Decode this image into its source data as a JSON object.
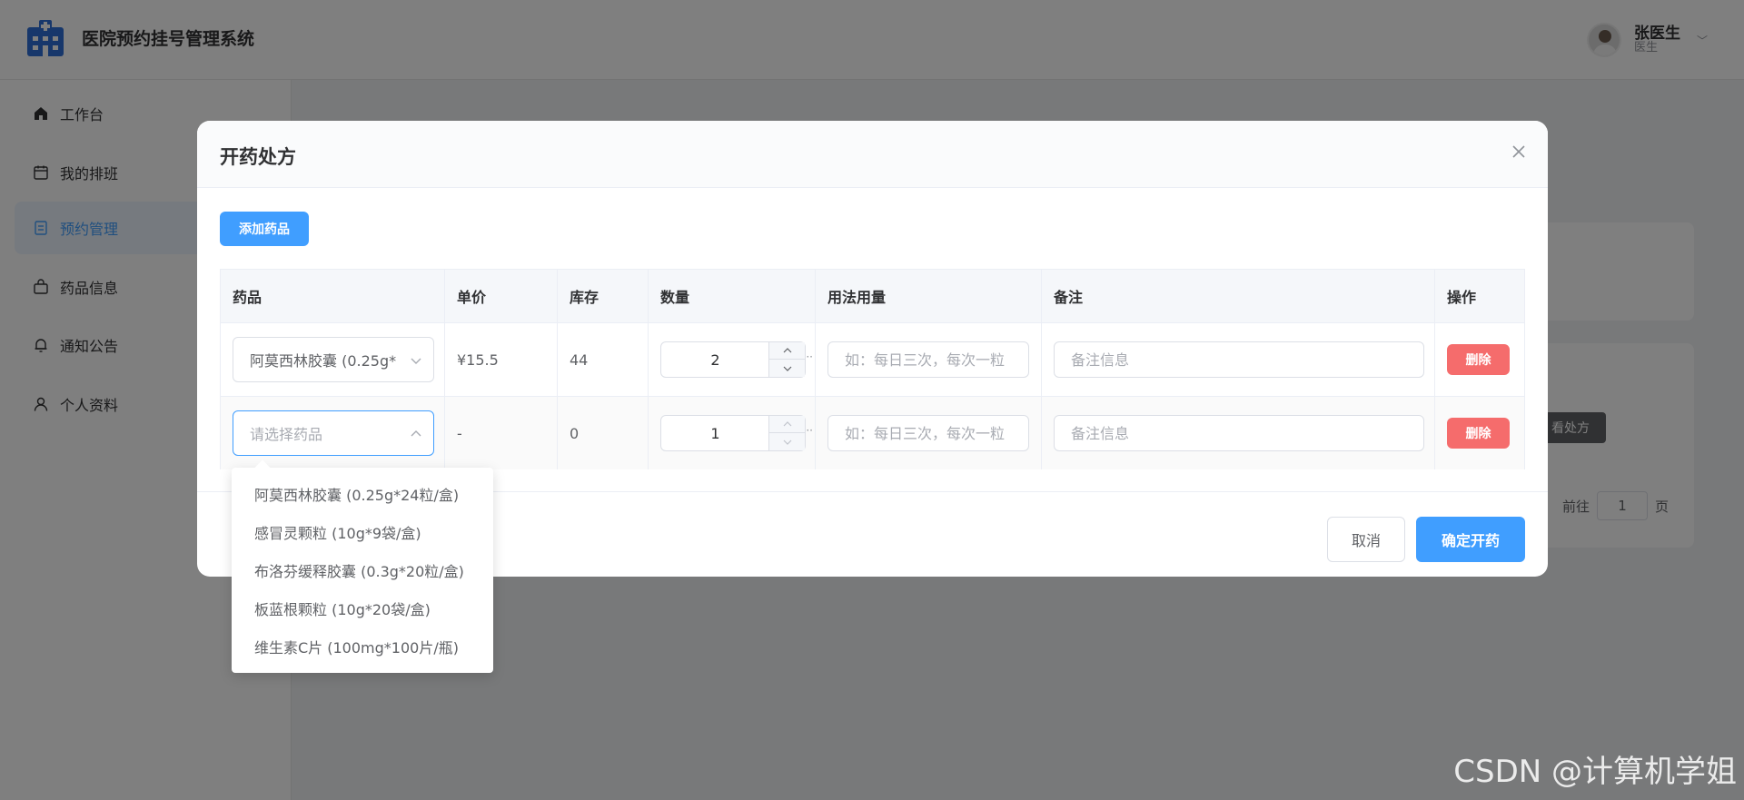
{
  "app": {
    "title": "医院预约挂号管理系统",
    "user_name": "张医生",
    "user_role": "医生"
  },
  "sidebar": {
    "items": [
      {
        "label": "工作台",
        "icon": "home-icon"
      },
      {
        "label": "我的排班",
        "icon": "calendar-icon"
      },
      {
        "label": "预约管理",
        "icon": "document-icon",
        "active": true
      },
      {
        "label": "药品信息",
        "icon": "bag-icon"
      },
      {
        "label": "通知公告",
        "icon": "bell-icon"
      },
      {
        "label": "个人资料",
        "icon": "user-icon"
      }
    ]
  },
  "background": {
    "view_button": "看处方",
    "pager_prefix": "前往",
    "pager_value": "1",
    "pager_suffix": "页"
  },
  "dialog": {
    "title": "开药处方",
    "add_button": "添加药品",
    "columns": [
      "药品",
      "单价",
      "库存",
      "数量",
      "用法用量",
      "备注",
      "操作"
    ],
    "rows": [
      {
        "drug": "阿莫西林胶囊 (0.25g*",
        "price": "¥15.5",
        "stock": "44",
        "quantity": "2",
        "usage_placeholder": "如：每日三次，每次一粒",
        "remark_placeholder": "备注信息",
        "delete": "删除"
      },
      {
        "drug_placeholder": "请选择药品",
        "price": "-",
        "stock": "0",
        "quantity": "1",
        "usage_placeholder": "如：每日三次，每次一粒",
        "remark_placeholder": "备注信息",
        "delete": "删除"
      }
    ],
    "cancel_button": "取消",
    "confirm_button": "确定开药"
  },
  "dropdown": {
    "options": [
      "阿莫西林胶囊 (0.25g*24粒/盒)",
      "感冒灵颗粒 (10g*9袋/盒)",
      "布洛芬缓释胶囊 (0.3g*20粒/盒)",
      "板蓝根颗粒 (10g*20袋/盒)",
      "维生素C片 (100mg*100片/瓶)"
    ]
  },
  "watermark": "CSDN @计算机学姐",
  "colors": {
    "primary": "#409eff",
    "danger": "#f56c6c",
    "overlay": "rgba(0,0,0,0.5)"
  }
}
